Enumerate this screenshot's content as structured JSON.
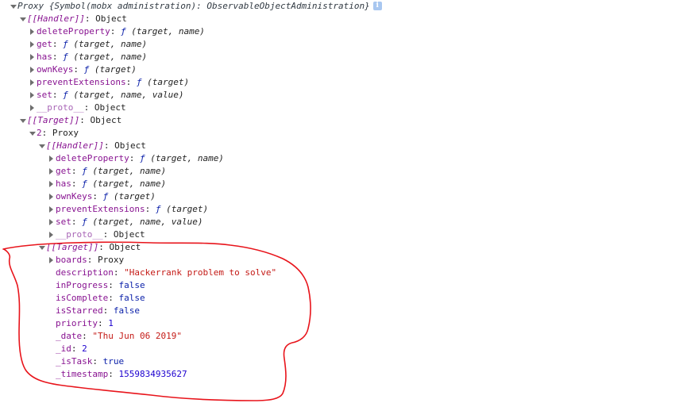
{
  "header": {
    "title": "Proxy {Symbol(mobx administration): ObservableObjectAdministration}",
    "info_icon": "info-icon"
  },
  "rows": [
    {
      "indent": 0,
      "toggle": "down",
      "header": true,
      "key": "Proxy {Symbol(mobx administration): ObservableObjectAdministration}",
      "info": true
    },
    {
      "indent": 1,
      "toggle": "down",
      "keyType": "internal",
      "key": "[[Handler]]",
      "valType": "obj",
      "value": "Object"
    },
    {
      "indent": 2,
      "toggle": "right",
      "keyType": "normal",
      "key": "deleteProperty",
      "valType": "fn",
      "value": "(target, name)"
    },
    {
      "indent": 2,
      "toggle": "right",
      "keyType": "normal",
      "key": "get",
      "valType": "fn",
      "value": "(target, name)"
    },
    {
      "indent": 2,
      "toggle": "right",
      "keyType": "normal",
      "key": "has",
      "valType": "fn",
      "value": "(target, name)"
    },
    {
      "indent": 2,
      "toggle": "right",
      "keyType": "normal",
      "key": "ownKeys",
      "valType": "fn",
      "value": "(target)"
    },
    {
      "indent": 2,
      "toggle": "right",
      "keyType": "normal",
      "key": "preventExtensions",
      "valType": "fn",
      "value": "(target)"
    },
    {
      "indent": 2,
      "toggle": "right",
      "keyType": "normal",
      "key": "set",
      "valType": "fn",
      "value": "(target, name, value)"
    },
    {
      "indent": 2,
      "toggle": "right",
      "keyType": "proto",
      "key": "__proto__",
      "valType": "obj",
      "value": "Object"
    },
    {
      "indent": 1,
      "toggle": "down",
      "keyType": "internal",
      "key": "[[Target]]",
      "valType": "obj",
      "value": "Object"
    },
    {
      "indent": 2,
      "toggle": "down",
      "keyType": "normal",
      "key": "2",
      "valType": "obj",
      "value": "Proxy"
    },
    {
      "indent": 3,
      "toggle": "down",
      "keyType": "internal",
      "key": "[[Handler]]",
      "valType": "obj",
      "value": "Object"
    },
    {
      "indent": 4,
      "toggle": "right",
      "keyType": "normal",
      "key": "deleteProperty",
      "valType": "fn",
      "value": "(target, name)"
    },
    {
      "indent": 4,
      "toggle": "right",
      "keyType": "normal",
      "key": "get",
      "valType": "fn",
      "value": "(target, name)"
    },
    {
      "indent": 4,
      "toggle": "right",
      "keyType": "normal",
      "key": "has",
      "valType": "fn",
      "value": "(target, name)"
    },
    {
      "indent": 4,
      "toggle": "right",
      "keyType": "normal",
      "key": "ownKeys",
      "valType": "fn",
      "value": "(target)"
    },
    {
      "indent": 4,
      "toggle": "right",
      "keyType": "normal",
      "key": "preventExtensions",
      "valType": "fn",
      "value": "(target)"
    },
    {
      "indent": 4,
      "toggle": "right",
      "keyType": "normal",
      "key": "set",
      "valType": "fn",
      "value": "(target, name, value)"
    },
    {
      "indent": 4,
      "toggle": "right",
      "keyType": "proto",
      "key": "__proto__",
      "valType": "obj",
      "value": "Object"
    },
    {
      "indent": 3,
      "toggle": "down",
      "keyType": "internal",
      "key": "[[Target]]",
      "valType": "obj",
      "value": "Object"
    },
    {
      "indent": 4,
      "toggle": "right",
      "keyType": "normal",
      "key": "boards",
      "valType": "obj",
      "value": "Proxy"
    },
    {
      "indent": 4,
      "toggle": "none",
      "keyType": "normal",
      "key": "description",
      "valType": "str",
      "value": "\"Hackerrank problem to solve\""
    },
    {
      "indent": 4,
      "toggle": "none",
      "keyType": "normal",
      "key": "inProgress",
      "valType": "bool",
      "value": "false"
    },
    {
      "indent": 4,
      "toggle": "none",
      "keyType": "normal",
      "key": "isComplete",
      "valType": "bool",
      "value": "false"
    },
    {
      "indent": 4,
      "toggle": "none",
      "keyType": "normal",
      "key": "isStarred",
      "valType": "bool",
      "value": "false"
    },
    {
      "indent": 4,
      "toggle": "none",
      "keyType": "normal",
      "key": "priority",
      "valType": "num",
      "value": "1"
    },
    {
      "indent": 4,
      "toggle": "none",
      "keyType": "normal",
      "key": "_date",
      "valType": "str",
      "value": "\"Thu Jun 06 2019\""
    },
    {
      "indent": 4,
      "toggle": "none",
      "keyType": "normal",
      "key": "_id",
      "valType": "num",
      "value": "2"
    },
    {
      "indent": 4,
      "toggle": "none",
      "keyType": "normal",
      "key": "_isTask",
      "valType": "bool",
      "value": "true"
    },
    {
      "indent": 4,
      "toggle": "none",
      "keyType": "normal",
      "key": "_timestamp",
      "valType": "num",
      "value": "1559834935627"
    }
  ],
  "annotation": {
    "color": "#e8141b"
  },
  "colors": {
    "key": "#881391",
    "string": "#c41a16",
    "number": "#1c00cf",
    "boolean": "#0d22aa"
  }
}
